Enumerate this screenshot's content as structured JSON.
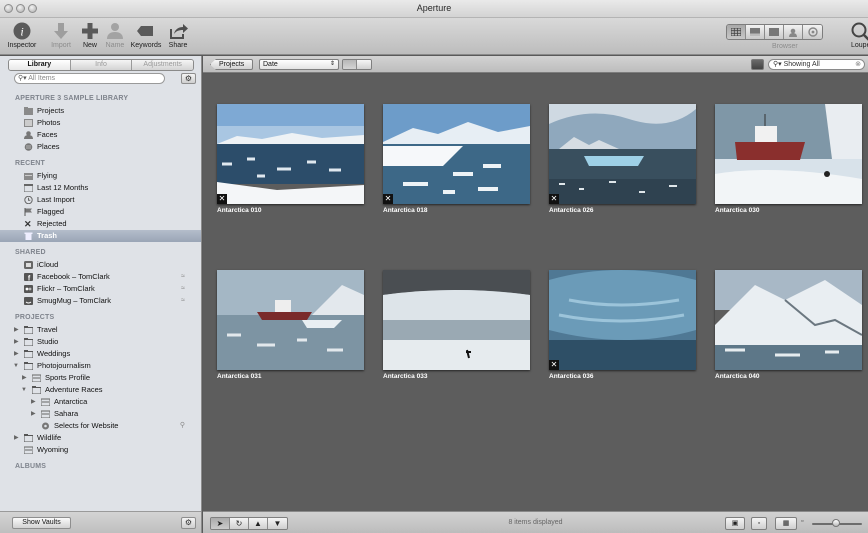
{
  "window": {
    "title": "Aperture"
  },
  "toolbar": {
    "inspector": "Inspector",
    "import": "Import",
    "new": "New",
    "name": "Name",
    "keywords": "Keywords",
    "share": "Share",
    "browser": "Browser",
    "loupe": "Loupe"
  },
  "sidebar": {
    "tabs": [
      "Library",
      "Info",
      "Adjustments"
    ],
    "search_placeholder": "All Items",
    "sections": {
      "library": "APERTURE 3 SAMPLE LIBRARY",
      "recent": "RECENT",
      "shared": "SHARED",
      "projects": "PROJECTS",
      "albums": "ALBUMS"
    },
    "library_items": [
      "Projects",
      "Photos",
      "Faces",
      "Places"
    ],
    "recent_items": [
      "Flying",
      "Last 12 Months",
      "Last Import",
      "Flagged",
      "Rejected",
      "Trash"
    ],
    "shared_items": [
      "iCloud",
      "Facebook – TomClark",
      "Flickr – TomClark",
      "SmugMug – TomClark"
    ],
    "project_items": [
      "Travel",
      "Studio",
      "Weddings",
      "Photojournalism",
      "Sports Profile",
      "Adventure Races",
      "Antarctica",
      "Sahara",
      "Selects for Website",
      "Wildlife",
      "Wyoming"
    ],
    "show_vaults": "Show Vaults"
  },
  "browser_header": {
    "back_button": "Projects",
    "sort": "Date",
    "filter": "Showing All"
  },
  "photos": [
    {
      "caption": "Antarctica 010",
      "rejected": true
    },
    {
      "caption": "Antarctica 018",
      "rejected": true
    },
    {
      "caption": "Antarctica 026",
      "rejected": true
    },
    {
      "caption": "Antarctica 030",
      "rejected": false
    },
    {
      "caption": "Antarctica 031",
      "rejected": false
    },
    {
      "caption": "Antarctica 033",
      "rejected": false
    },
    {
      "caption": "Antarctica 036",
      "rejected": true
    },
    {
      "caption": "Antarctica 040",
      "rejected": false
    }
  ],
  "footer": {
    "count": "8 items displayed"
  },
  "colors": {
    "selection": "#9aa5b6",
    "browser_bg": "#5d5d5d",
    "sidebar_bg": "#dfe2e7"
  }
}
